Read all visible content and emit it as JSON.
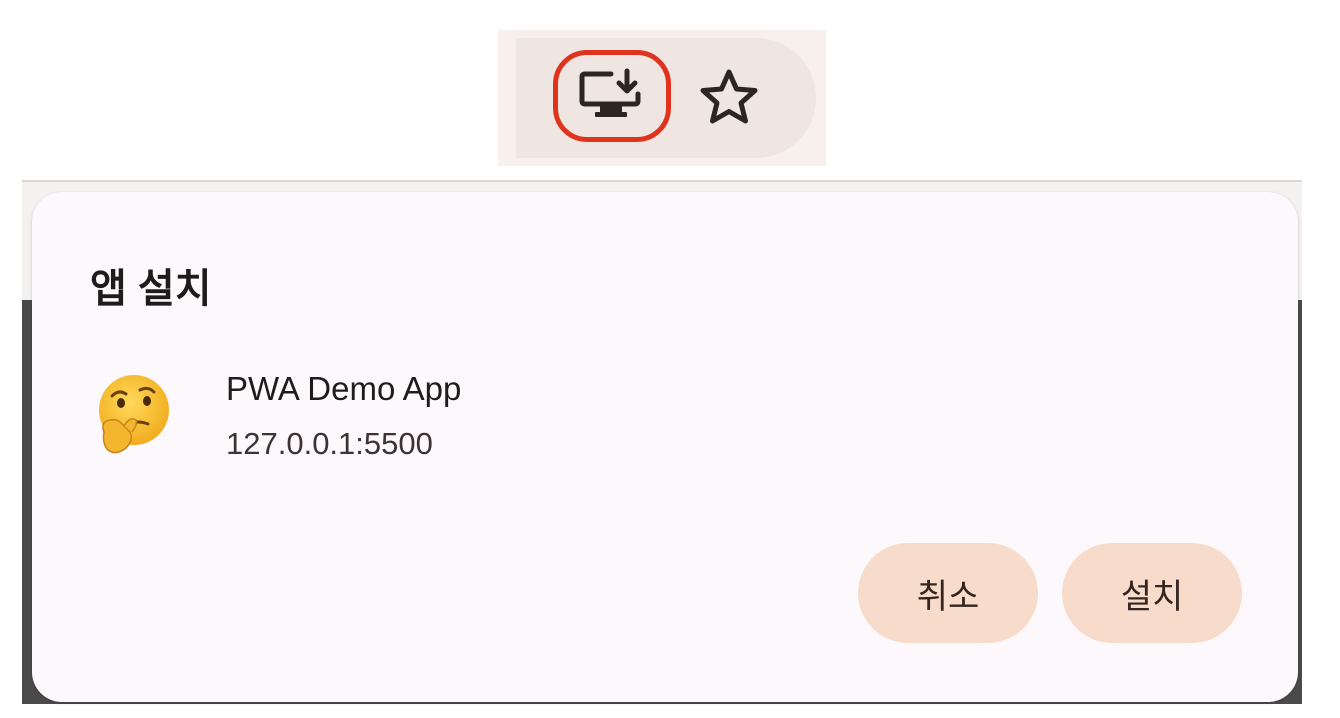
{
  "toolbar": {
    "install_icon": "install-desktop-icon",
    "bookmark_icon": "star-outline-icon",
    "highlight_color": "#e0331e"
  },
  "dialog": {
    "title": "앱 설치",
    "app": {
      "icon": "thinking-face-emoji",
      "name": "PWA Demo App",
      "origin": "127.0.0.1:5500"
    },
    "buttons": {
      "cancel": "취소",
      "install": "설치"
    },
    "button_color": "#f8dccb"
  }
}
